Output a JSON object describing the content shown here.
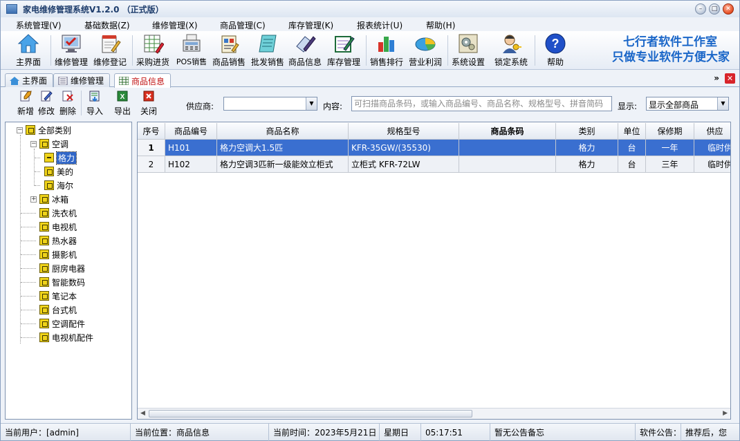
{
  "window": {
    "title": "家电维修管理系统V1.2.0 （正式版）"
  },
  "menu": [
    "系统管理(V)",
    "基础数据(Z)",
    "维修管理(X)",
    "商品管理(C)",
    "库存管理(K)",
    "报表统计(U)",
    "帮助(H)"
  ],
  "toolbar": {
    "buttons": [
      {
        "label": "主界面",
        "icon": "home-icon"
      },
      {
        "label": "维修管理",
        "icon": "monitor-check-icon"
      },
      {
        "label": "维修登记",
        "icon": "notepad-pen-icon"
      },
      {
        "label": "采购进货",
        "icon": "spreadsheet-pen-icon"
      },
      {
        "label": "POS销售",
        "icon": "cash-register-icon"
      },
      {
        "label": "商品销售",
        "icon": "product-sale-icon"
      },
      {
        "label": "批发销售",
        "icon": "notebook-icon"
      },
      {
        "label": "商品信息",
        "icon": "pen-edit-icon"
      },
      {
        "label": "库存管理",
        "icon": "pencil-board-icon"
      },
      {
        "label": "销售排行",
        "icon": "bar-chart-icon"
      },
      {
        "label": "营业利润",
        "icon": "pie-coin-icon"
      },
      {
        "label": "系统设置",
        "icon": "gears-icon"
      },
      {
        "label": "锁定系统",
        "icon": "user-key-icon"
      },
      {
        "label": "帮助",
        "icon": "help-icon"
      }
    ],
    "brand_line1": "七行者软件工作室",
    "brand_line2": "只做专业软件方便大家"
  },
  "tabs": [
    {
      "label": "主界面",
      "active": false
    },
    {
      "label": "维修管理",
      "active": false
    },
    {
      "label": "商品信息",
      "active": true
    }
  ],
  "subbar": {
    "buttons": [
      "新增",
      "修改",
      "删除",
      "导入",
      "导出",
      "关闭"
    ],
    "supplier_label": "供应商:",
    "supplier_value": "",
    "content_label": "内容:",
    "content_placeholder": "可扫描商品条码，或输入商品编号、商品名称、规格型号、拼音简码",
    "display_label": "显示:",
    "display_value": "显示全部商品"
  },
  "tree": {
    "root": "全部类别",
    "nodes": [
      {
        "label": "空调",
        "level": 1,
        "expanded": true
      },
      {
        "label": "格力",
        "level": 2,
        "selected": true
      },
      {
        "label": "美的",
        "level": 2
      },
      {
        "label": "海尔",
        "level": 2
      },
      {
        "label": "冰箱",
        "level": 1,
        "collapsed": true
      },
      {
        "label": "洗衣机",
        "level": 1
      },
      {
        "label": "电视机",
        "level": 1
      },
      {
        "label": "热水器",
        "level": 1
      },
      {
        "label": "摄影机",
        "level": 1
      },
      {
        "label": "厨房电器",
        "level": 1
      },
      {
        "label": "智能数码",
        "level": 1
      },
      {
        "label": "笔记本",
        "level": 1
      },
      {
        "label": "台式机",
        "level": 1
      },
      {
        "label": "空调配件",
        "level": 1
      },
      {
        "label": "电视机配件",
        "level": 1
      }
    ]
  },
  "grid": {
    "columns": [
      "序号",
      "商品编号",
      "商品名称",
      "规格型号",
      "商品条码",
      "类别",
      "单位",
      "保修期",
      "供应"
    ],
    "rows": [
      {
        "no": "1",
        "code": "H101",
        "name": "格力空调大1.5匹",
        "model": "KFR-35GW/(35530)",
        "barcode": "",
        "category": "格力",
        "unit": "台",
        "warranty": "一年",
        "supplier": "临时供"
      },
      {
        "no": "2",
        "code": "H102",
        "name": "格力空调3匹新一级能效立柜式",
        "model": "立柜式 KFR-72LW",
        "barcode": "",
        "category": "格力",
        "unit": "台",
        "warranty": "三年",
        "supplier": "临时供"
      }
    ]
  },
  "status": {
    "user": "当前用户：[admin]",
    "location": "当前位置：商品信息",
    "date": "当前时间：2023年5月21日",
    "weekday": "星期日",
    "time": "05:17:51",
    "memo": "暂无公告备忘",
    "notice": "软件公告：",
    "notice_text": "推荐后，您"
  }
}
